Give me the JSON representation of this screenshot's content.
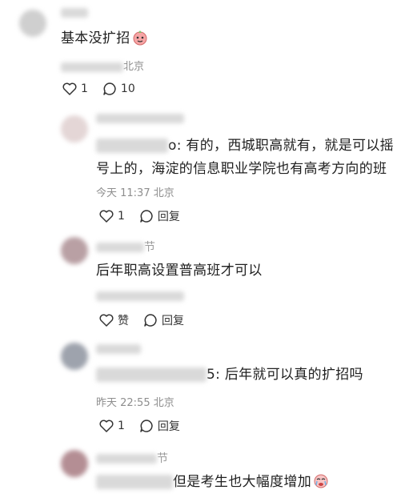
{
  "comments": [
    {
      "name_suffix": "",
      "text": "基本没扩招",
      "emoji": "face-icon",
      "meta": "北京",
      "like_count": "1",
      "reply_label": "10"
    },
    {
      "name_suffix": "",
      "text_prefix": "o: 有的，西城职高就有，就是可以摇",
      "text_line2": "号上的，海淀的信息职业学院也有高考方向的班",
      "meta": "今天 11:37 北京",
      "like_count": "1",
      "reply_label": "回复"
    },
    {
      "name_suffix": "节",
      "text": "后年职高设置普高班才可以",
      "meta": "",
      "like_label": "赞",
      "reply_label": "回复"
    },
    {
      "name_suffix": "",
      "text_prefix": "5: 后年就可以真的扩招吗",
      "meta": "昨天 22:55 北京",
      "like_count": "1",
      "reply_label": "回复"
    },
    {
      "name_suffix": "节",
      "text_prefix": "但是考生也大幅度增加",
      "emoji": "crying-face-icon"
    }
  ],
  "colors": {
    "heart": "#333333",
    "accent_emoji": "#f08a8a"
  }
}
